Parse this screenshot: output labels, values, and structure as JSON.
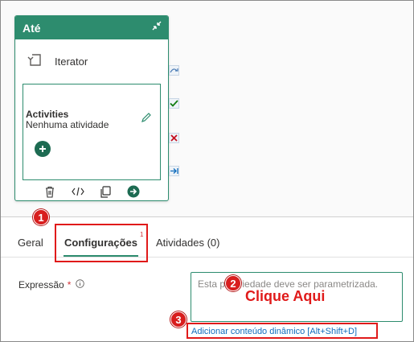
{
  "activity_card": {
    "title": "Até",
    "iterator_label": "Iterator",
    "activities_title": "Activities",
    "activities_status": "Nenhuma atividade",
    "color": "#2d8c6e"
  },
  "tabs": [
    {
      "label": "Geral",
      "active": false
    },
    {
      "label": "Configurações",
      "active": true,
      "badge": "1"
    },
    {
      "label": "Atividades (0)",
      "active": false
    }
  ],
  "expression": {
    "label": "Expressão",
    "required_marker": "*",
    "placeholder": "Esta propriedade deve ser parametrizada.",
    "dynamic_content_link": "Adicionar conteúdo dinâmico [Alt+Shift+D]"
  },
  "annotations": {
    "step1": "1",
    "step2": "2",
    "step3": "3",
    "callout": "Clique Aqui",
    "color": "#e01a1a"
  },
  "icons": {
    "collapse": "collapse-icon",
    "iterator": "iterator-icon",
    "edit": "pencil-icon",
    "add": "add-icon",
    "delete": "trash-icon",
    "code": "code-icon",
    "copy": "copy-icon",
    "go": "arrow-right-icon",
    "skip": "skip-icon",
    "success": "check-icon",
    "failure": "x-icon",
    "completion": "arrow-icon",
    "info": "info-icon"
  }
}
